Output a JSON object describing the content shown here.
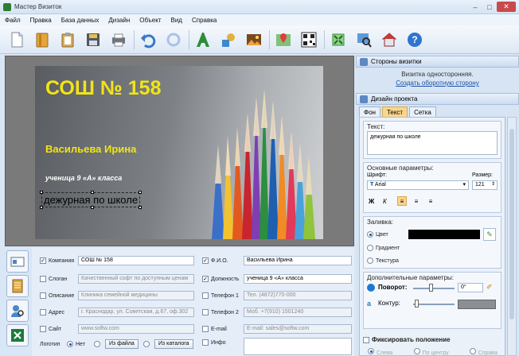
{
  "window": {
    "title": "Мастер Визиток",
    "min": "–",
    "max": "□",
    "close": "✕"
  },
  "menu": [
    "Файл",
    "Правка",
    "База данных",
    "Дизайн",
    "Объект",
    "Вид",
    "Справка"
  ],
  "card": {
    "school": "СОШ № 158",
    "name": "Васильева Ирина",
    "position": "ученица 9 «А» класса",
    "duty": "дежурная по школе"
  },
  "fields": {
    "company": {
      "label": "Компания",
      "value": "СОШ № 158"
    },
    "slogan": {
      "label": "Слоган",
      "value": "Качественный софт по доступным ценам"
    },
    "description": {
      "label": "Описание",
      "value": "Клиника семейной медицины"
    },
    "address": {
      "label": "Адрес",
      "value": "г. Краснодар, ул. Советская, д.67, оф.302"
    },
    "site": {
      "label": "Сайт",
      "value": "www.softw.com"
    },
    "logo": {
      "label": "Логотип",
      "no": "Нет",
      "from_file": "Из файла",
      "from_catalog": "Из каталога"
    },
    "fio": {
      "label": "Ф.И.О.",
      "value": "Васильева Ирина"
    },
    "job": {
      "label": "Должность",
      "value": "ученица 9 «А» класса"
    },
    "phone1": {
      "label": "Телефон 1",
      "value": "Тел. (4872)770-000"
    },
    "phone2": {
      "label": "Телефон 2",
      "value": "Моб. +7(910) 1501240"
    },
    "email": {
      "label": "E-mail",
      "value": "E-mail: sales@softw.com"
    },
    "info": {
      "label": "Инфо",
      "value": ""
    }
  },
  "right": {
    "sides_title": "Стороны визитки",
    "sides_info": "Визитка односторонняя.",
    "sides_link": "Создать оборотную сторону",
    "design_title": "Дизайн проекта",
    "tabs": [
      "Фон",
      "Текст",
      "Сетка"
    ],
    "text_group": "Текст:",
    "text_value": "дежурная по школе",
    "basic_group": "Основные параметры:",
    "font_label": "Шрифт:",
    "font_value": "Arial",
    "size_label": "Размер:",
    "size_value": "121",
    "fill_group": "Заливка:",
    "fill_color": "Цвет",
    "fill_gradient": "Градиент",
    "fill_texture": "Текстура",
    "extra_group": "Дополнительные параметры:",
    "rotate_label": "Поворот:",
    "rotate_value": "0°",
    "outline_label": "Контур:",
    "fix_label": "Фиксировать положение",
    "align_left": "Слева",
    "align_center": "По центру",
    "align_right": "Справа",
    "bold_btn": "Ж",
    "italic_btn": "К"
  },
  "colors": {
    "accent_yellow": "#f2e416",
    "tab_active": "#fbd58b",
    "link": "#1b4fa3",
    "fill_black": "#000000",
    "outline_gray": "#8a8f96"
  }
}
